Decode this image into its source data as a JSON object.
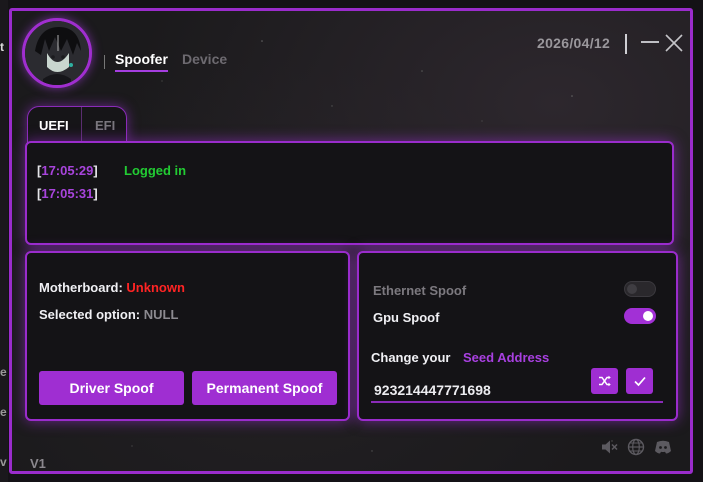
{
  "header": {
    "nav_tabs": [
      {
        "label": "Spoofer",
        "active": true
      },
      {
        "label": "Device",
        "active": false
      }
    ],
    "date": "2026/04/12"
  },
  "mode_tabs": [
    {
      "label": "UEFI",
      "active": true
    },
    {
      "label": "EFI",
      "active": false
    }
  ],
  "log": {
    "entries": [
      {
        "time": "17:05:29",
        "message": "Logged in"
      },
      {
        "time": "17:05:31",
        "message": ""
      }
    ]
  },
  "info": {
    "motherboard_label": "Motherboard:",
    "motherboard_value": "Unknown",
    "selected_option_label": "Selected option:",
    "selected_option_value": "NULL",
    "driver_spoof_button": "Driver Spoof",
    "permanent_spoof_button": "Permanent Spoof"
  },
  "options": {
    "ethernet_spoof": {
      "label": "Ethernet Spoof",
      "enabled": false
    },
    "gpu_spoof": {
      "label": "Gpu Spoof",
      "enabled": true
    },
    "change_your_label": "Change your",
    "seed_address_label": "Seed Address",
    "seed_value": "923214447771698"
  },
  "footer": {
    "version": "V1",
    "icons": [
      "mute-icon",
      "globe-icon",
      "discord-icon"
    ]
  },
  "colors": {
    "accent": "#9f2ed2",
    "success": "#22cc33",
    "error": "#ff2424"
  }
}
